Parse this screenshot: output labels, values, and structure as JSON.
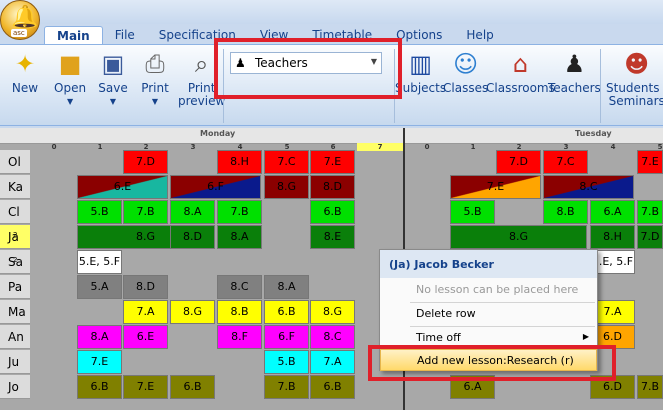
{
  "app": {
    "icon_label": "asc"
  },
  "tabs": [
    {
      "label": "Main",
      "active": true
    },
    {
      "label": "File"
    },
    {
      "label": "Specification"
    },
    {
      "label": "View"
    },
    {
      "label": "Timetable"
    },
    {
      "label": "Options"
    },
    {
      "label": "Help"
    }
  ],
  "ribbon": {
    "new": "New",
    "open": "Open",
    "save": "Save",
    "print": "Print",
    "print_preview_1": "Print",
    "print_preview_2": "preview",
    "subjects": "Subjects",
    "classes": "Classes",
    "classrooms": "Classrooms",
    "teachers": "Teachers",
    "students_1": "Students /",
    "students_2": "Seminars",
    "view_select": "Teachers"
  },
  "grid": {
    "days": [
      "Monday",
      "Tuesday"
    ],
    "periods": [
      "0",
      "1",
      "2",
      "3",
      "4",
      "5",
      "6",
      "7"
    ],
    "periods_tue": [
      "0",
      "1",
      "2",
      "3",
      "4",
      "5"
    ],
    "rows": [
      "Ol",
      "Ka",
      "Cl",
      "Ja",
      "Sa",
      "Pa",
      "Ma",
      "An",
      "Ju",
      "Jo"
    ],
    "subscripts": {
      "Ja": "2",
      "Sa": "2"
    },
    "cells": {
      "ol_2": "7.D",
      "ol_4": "8.H",
      "ol_5": "7.C",
      "ol_6": "7.E",
      "ol_t2": "7.D",
      "ol_t3": "7.C",
      "ol_t5": "7.E",
      "ka_1": "6.E",
      "ka_3": "6.F",
      "ka_5": "8.G",
      "ka_6": "8.D",
      "ka_t1": "7.E",
      "ka_t3": "8.C",
      "cl_1": "5.B",
      "cl_2": "7.B",
      "cl_3": "8.A",
      "cl_4": "7.B",
      "cl_6": "6.B",
      "cl_t1": "5.B",
      "cl_t3": "8.B",
      "cl_t4": "6.A",
      "cl_t5": "7.B",
      "ja_2": "8.G",
      "ja_3": "8.D",
      "ja_4": "8.A",
      "ja_6": "8.E",
      "ja_t3": "8.G",
      "ja_t4": "8.H",
      "ja_t5": "7.D",
      "sa_1": "5.E, 5.F",
      "sa_t4": "5.E, 5.F",
      "pa_2": "5.A",
      "pa_3": "8.D",
      "pa_5": "8.C",
      "pa_6": "8.A",
      "ma_2": "7.A",
      "ma_3": "8.G",
      "ma_4": "8.B",
      "ma_5": "6.B",
      "ma_6": "8.G",
      "ma_t4": "7.A",
      "an_1": "8.A",
      "an_2": "6.E",
      "an_4": "8.F",
      "an_5": "6.F",
      "an_6": "8.C",
      "an_t4": "6.D",
      "ju_1": "7.E",
      "ju_5": "5.B",
      "ju_6": "7.A",
      "jo_1": "6.B",
      "jo_2": "7.E",
      "jo_3": "6.B",
      "jo_5": "7.B",
      "jo_6": "6.B",
      "jo_t1": "6.A",
      "jo_t4": "6.D",
      "jo_t5": "7.B"
    },
    "colors": {
      "red": "#ff0000",
      "darkred": "#8b0000",
      "navy": "#0a1a8c",
      "teal": "#18b7a0",
      "green": "#00e000",
      "darkgreen": "#0a7f0a",
      "gray": "#808080",
      "yellow": "#ffff00",
      "magenta": "#ff00ff",
      "cyan": "#00ffff",
      "olive": "#808000",
      "orange": "#ffa500",
      "white": "#ffffff"
    }
  },
  "context_menu": {
    "header": "(Ja) Jacob Becker",
    "items": [
      {
        "label": "No lesson can be placed here",
        "disabled": true
      },
      {
        "label": "Delete row"
      },
      {
        "label": "Time off"
      },
      {
        "label": "Add new lesson:Research (r)",
        "selected": true
      }
    ]
  }
}
